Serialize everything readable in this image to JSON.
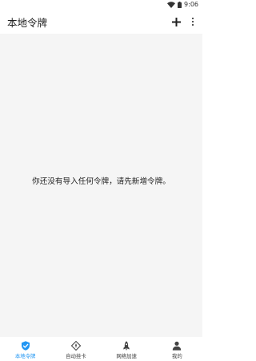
{
  "status_bar": {
    "time": "9:06"
  },
  "header": {
    "title": "本地令牌",
    "add_icon": "plus-icon",
    "more_icon": "more-vert-icon"
  },
  "main": {
    "empty_message": "你还没有导入任何令牌，请先新增令牌。"
  },
  "bottom_nav": {
    "active_color": "#2196f3",
    "items": [
      {
        "label": "本地令牌",
        "icon": "shield-check-icon",
        "active": true
      },
      {
        "label": "自动挂卡",
        "icon": "diamond-icon",
        "active": false
      },
      {
        "label": "网络加速",
        "icon": "rocket-icon",
        "active": false
      },
      {
        "label": "我的",
        "icon": "person-icon",
        "active": false
      }
    ]
  }
}
